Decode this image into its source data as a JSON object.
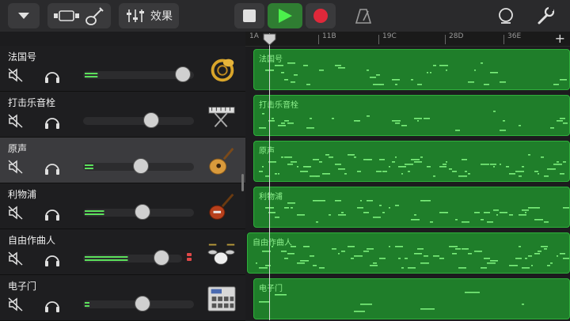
{
  "toolbar": {
    "effects_label": "效果",
    "buttons": [
      "browser-dropdown",
      "tracks-view",
      "instrument",
      "mixer",
      "effects"
    ],
    "transport": [
      "stop",
      "play",
      "record"
    ],
    "right": [
      "metronome",
      "loop",
      "settings"
    ]
  },
  "ruler": {
    "markers": [
      "1A",
      "11B",
      "19C",
      "28D",
      "36E"
    ],
    "add_label": "+"
  },
  "colors": {
    "region_fill": "#1f7e2a",
    "region_border": "#2fae3b",
    "note_color": "#7cf07c",
    "play_green": "#2f7d32",
    "record_red": "#e0283a"
  },
  "tracks": [
    {
      "name": "法国号",
      "icon": "french-horn-icon",
      "volume": 0.95,
      "meter": 0.12,
      "selected": false,
      "region_label": "法国号"
    },
    {
      "name": "打击乐音栓",
      "icon": "keyboard-stand-icon",
      "volume": 0.62,
      "meter": 0.0,
      "selected": false,
      "region_label": "打击乐音栓"
    },
    {
      "name": "原声",
      "icon": "acoustic-guitar-icon",
      "volume": 0.52,
      "meter": 0.08,
      "selected": true,
      "region_label": "原声"
    },
    {
      "name": "利物浦",
      "icon": "bass-guitar-icon",
      "volume": 0.53,
      "meter": 0.18,
      "selected": false,
      "region_label": "利物浦"
    },
    {
      "name": "自由作曲人",
      "icon": "drum-kit-icon",
      "volume": 0.83,
      "meter": 0.45,
      "selected": false,
      "region_label": "自由作曲人",
      "peak": true
    },
    {
      "name": "电子门",
      "icon": "drum-machine-icon",
      "volume": 0.53,
      "meter": 0.04,
      "selected": false,
      "region_label": "电子门"
    }
  ]
}
